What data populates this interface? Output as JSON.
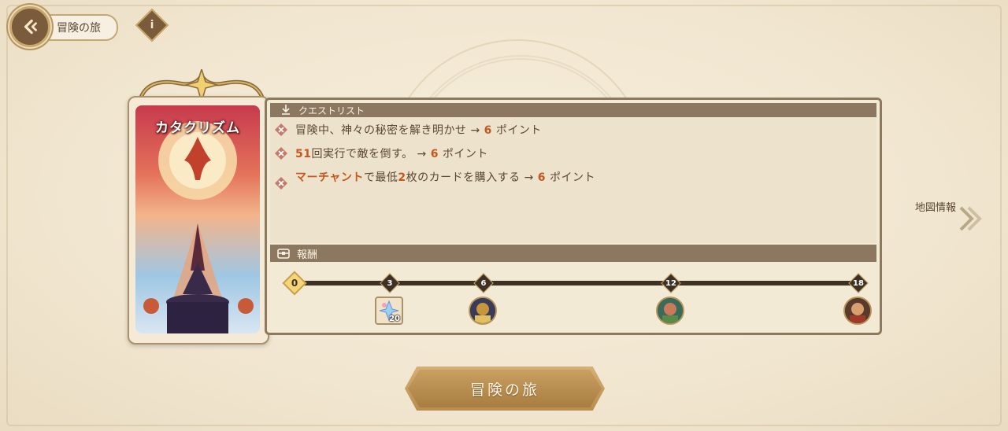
{
  "colors": {
    "accent": "#c6571e",
    "panel_header": "#8c7760",
    "button_gold": "#b88d4f",
    "background": "#f1e6d0"
  },
  "nav": {
    "back_icon": "back-arrow-icon",
    "breadcrumb": "冒険の旅",
    "info_icon_label": "i"
  },
  "card": {
    "title": "カタクリズム"
  },
  "quests": {
    "header": "クエストリスト",
    "items": [
      {
        "parts": [
          {
            "t": "冒険中、神々の秘密を解き明かせ → ",
            "hl": false
          },
          {
            "t": "6",
            "hl": true
          },
          {
            "t": " ポイント",
            "hl": false
          }
        ]
      },
      {
        "parts": [
          {
            "t": "51",
            "hl": true
          },
          {
            "t": "回実行で敵を倒す。 → ",
            "hl": false
          },
          {
            "t": "6",
            "hl": true
          },
          {
            "t": " ポイント",
            "hl": false
          }
        ]
      },
      {
        "parts": [
          {
            "t": "マーチャント",
            "hl": true
          },
          {
            "t": "で最低",
            "hl": false
          },
          {
            "t": "2",
            "hl": true
          },
          {
            "t": "枚のカードを購入する → ",
            "hl": false
          },
          {
            "t": "6",
            "hl": true
          },
          {
            "t": " ポイント",
            "hl": false
          }
        ]
      }
    ]
  },
  "rewards": {
    "header": "報酬",
    "milestones": [
      {
        "label": "0"
      },
      {
        "label": "3"
      },
      {
        "label": "6"
      },
      {
        "label": "12"
      },
      {
        "label": "18"
      }
    ],
    "items": [
      {
        "at": "3",
        "type": "item",
        "count": "20"
      },
      {
        "at": "6",
        "type": "hero-portrait"
      },
      {
        "at": "12",
        "type": "hero-portrait"
      },
      {
        "at": "18",
        "type": "hero-portrait"
      }
    ]
  },
  "map_info": {
    "label": "地図情報"
  },
  "start_button": {
    "label": "冒険の旅"
  }
}
